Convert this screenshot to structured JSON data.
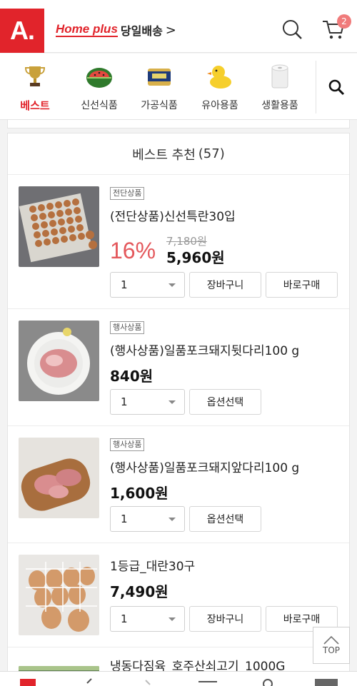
{
  "header": {
    "logo_text": "A.",
    "brand_name": "Home plus",
    "brand_sub": "당일배송",
    "brand_arrow": ">",
    "cart_count": "2",
    "brand_color": "#e1242b"
  },
  "categories": [
    {
      "label": "베스트",
      "icon": "trophy-icon",
      "active": true
    },
    {
      "label": "신선식품",
      "icon": "watermelon-icon",
      "active": false
    },
    {
      "label": "가공식품",
      "icon": "canned-ham-icon",
      "active": false
    },
    {
      "label": "유아용품",
      "icon": "rubber-duck-icon",
      "active": false
    },
    {
      "label": "생활용품",
      "icon": "toilet-paper-icon",
      "active": false
    }
  ],
  "list": {
    "title": "베스트 추천",
    "count": "(57)"
  },
  "products": [
    {
      "tag": "전단상품",
      "name": "(전단상품)신선특란30입",
      "discount": "16%",
      "original_price": "7,180원",
      "price": "5,960원",
      "qty": "1",
      "buttons": [
        "장바구니",
        "바로구매"
      ]
    },
    {
      "tag": "행사상품",
      "name": "(행사상품)일품포크돼지뒷다리100 g",
      "price": "840원",
      "qty": "1",
      "buttons": [
        "옵션선택"
      ]
    },
    {
      "tag": "행사상품",
      "name": "(행사상품)일품포크돼지앞다리100 g",
      "price": "1,600원",
      "qty": "1",
      "buttons": [
        "옵션선택"
      ]
    },
    {
      "name": "1등급_대란30구",
      "price": "7,490원",
      "qty": "1",
      "buttons": [
        "장바구니",
        "바로구매"
      ]
    },
    {
      "name": "냉동다짐육_호주산쇠고기_1000G"
    }
  ],
  "top_button": "TOP"
}
